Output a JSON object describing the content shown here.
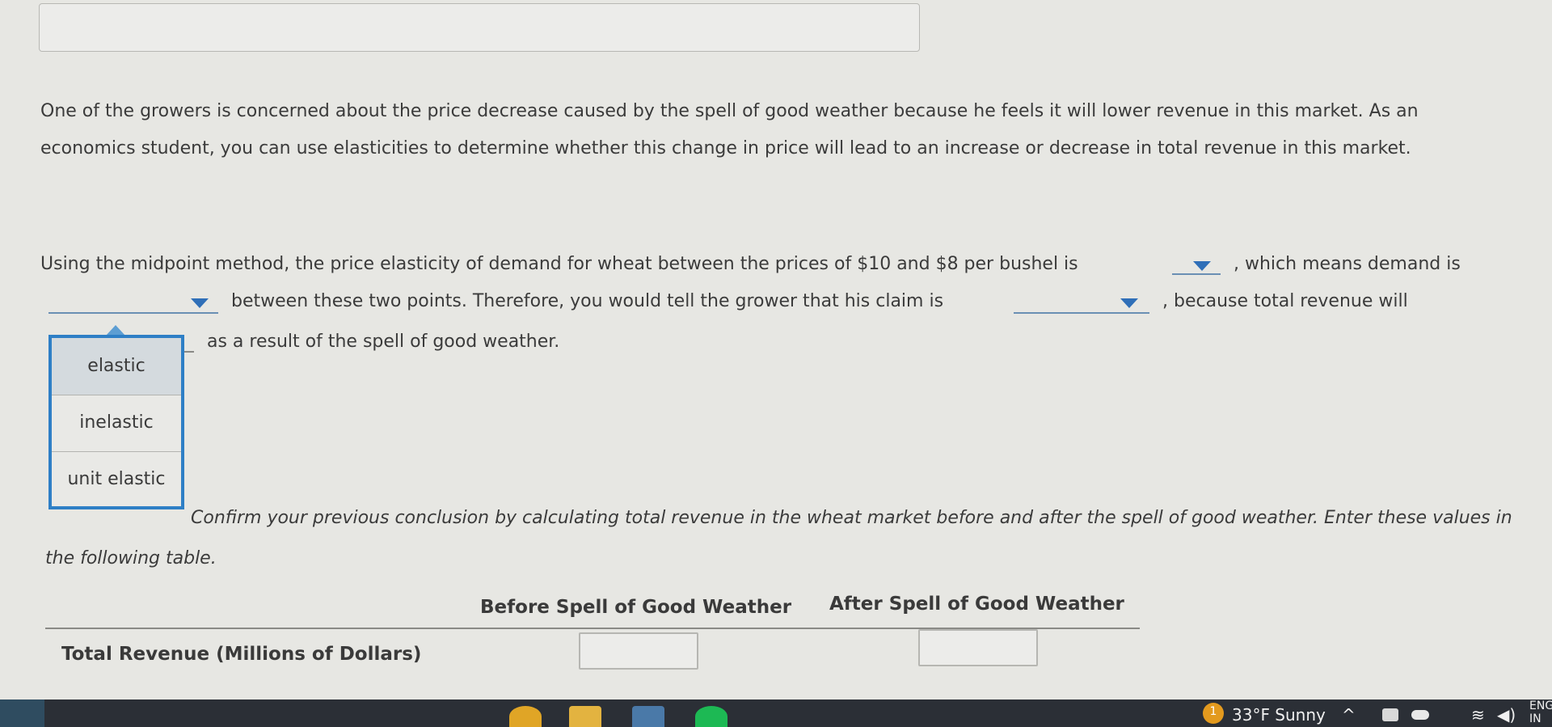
{
  "question": {
    "intro": "One of the growers is concerned about the price decrease caused by the spell of good weather because he feels it will lower revenue in this market. As an economics student, you can use elasticities to determine whether this change in price will lead to an increase or decrease in total revenue in this market.",
    "s1_part1": "Using the midpoint method, the price elasticity of demand for wheat between the prices of $10 and $8 per bushel is",
    "s1_part2": ", which means demand is",
    "s2_part1": "between these two points. Therefore, you would tell the grower that his claim is",
    "s2_part2": ", because total revenue will",
    "s3": "as a result of the spell of good weather.",
    "confirm_line1": "Confirm your previous conclusion by calculating total revenue in the wheat market before and after the spell of good weather. Enter these values in",
    "confirm_line2": "the following table."
  },
  "dropdown": {
    "options": [
      "elastic",
      "inelastic",
      "unit elastic"
    ],
    "highlighted": "elastic"
  },
  "table": {
    "col_before": "Before Spell of Good Weather",
    "col_after": "After Spell of Good Weather",
    "row_label": "Total Revenue (Millions of Dollars)",
    "before_value": "",
    "after_value": ""
  },
  "taskbar": {
    "weather_badge": "1",
    "weather": "33°F  Sunny",
    "lang1": "ENG",
    "lang2": "IN",
    "colors": {
      "bar": "#2b2f36",
      "chrome": "#e0a526",
      "files": "#e3b340",
      "spotify": "#1db954"
    }
  },
  "icons": [
    "up-arrow-icon",
    "speaker-icon",
    "wifi-icon",
    "battery-icon",
    "cloud-icon"
  ]
}
